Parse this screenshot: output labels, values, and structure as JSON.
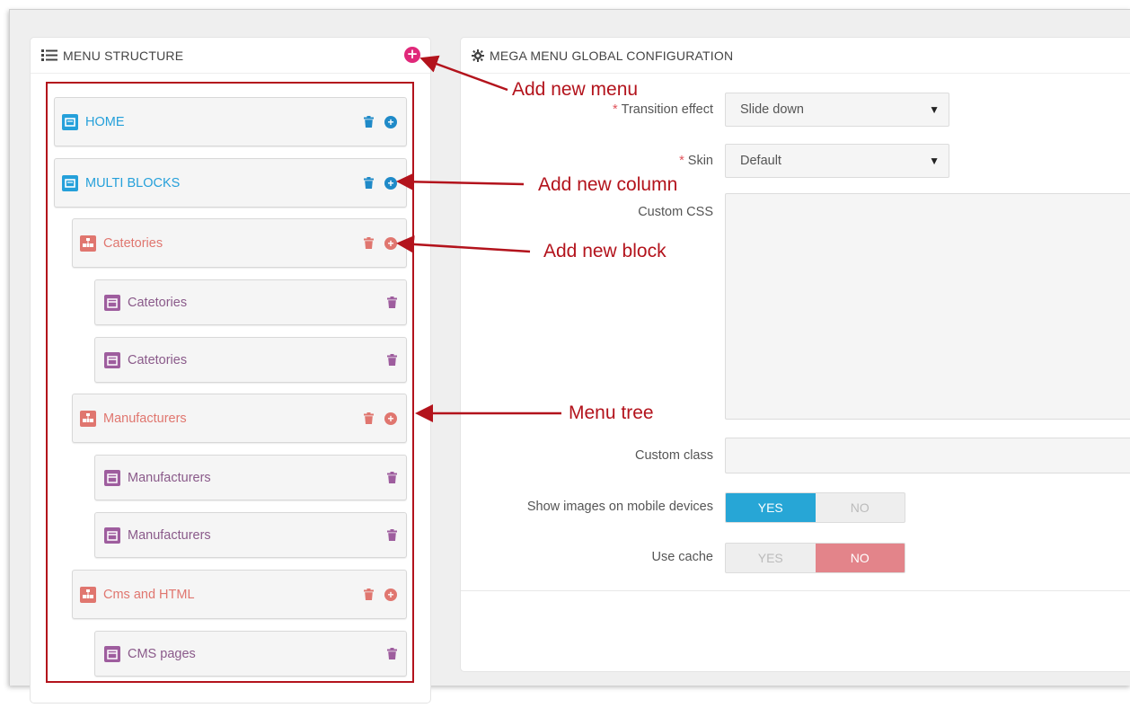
{
  "left_panel": {
    "title": "MENU STRUCTURE",
    "title_icon": "list-icon",
    "add_icon": "plus-circle-icon",
    "add_symbol": "+"
  },
  "tree": [
    {
      "label": "HOME",
      "kind": "menu",
      "icon": "book-icon",
      "color": "#25a0da",
      "actions": [
        "trash-icon",
        "plus-circle-icon"
      ]
    },
    {
      "label": "MULTI BLOCKS",
      "kind": "menu",
      "icon": "book-icon",
      "color": "#25a0da",
      "actions": [
        "trash-icon",
        "plus-circle-icon"
      ]
    },
    {
      "label": "Catetories",
      "kind": "column",
      "icon": "sitemap-icon",
      "color": "#e0766f",
      "actions": [
        "trash-icon",
        "plus-circle-icon"
      ]
    },
    {
      "label": "Catetories",
      "kind": "block",
      "icon": "calendar-icon",
      "color": "#9e5d9e",
      "actions": [
        "trash-icon"
      ]
    },
    {
      "label": "Catetories",
      "kind": "block",
      "icon": "calendar-icon",
      "color": "#9e5d9e",
      "actions": [
        "trash-icon"
      ]
    },
    {
      "label": "Manufacturers",
      "kind": "column",
      "icon": "sitemap-icon",
      "color": "#e0766f",
      "actions": [
        "trash-icon",
        "plus-circle-icon"
      ]
    },
    {
      "label": "Manufacturers",
      "kind": "block",
      "icon": "calendar-icon",
      "color": "#9e5d9e",
      "actions": [
        "trash-icon"
      ]
    },
    {
      "label": "Manufacturers",
      "kind": "block",
      "icon": "calendar-icon",
      "color": "#9e5d9e",
      "actions": [
        "trash-icon"
      ]
    },
    {
      "label": "Cms and HTML",
      "kind": "column",
      "icon": "sitemap-icon",
      "color": "#e0766f",
      "actions": [
        "trash-icon",
        "plus-circle-icon"
      ]
    },
    {
      "label": "CMS pages",
      "kind": "block",
      "icon": "calendar-icon",
      "color": "#9e5d9e",
      "actions": [
        "trash-icon"
      ]
    }
  ],
  "right_panel": {
    "title": "MEGA MENU GLOBAL CONFIGURATION",
    "title_icon": "gear-icon",
    "required_mark": "*",
    "fields": {
      "transition": {
        "label": "Transition effect",
        "value": "Slide down",
        "required": true
      },
      "skin": {
        "label": "Skin",
        "value": "Default",
        "required": true
      },
      "custom_css": {
        "label": "Custom CSS",
        "value": ""
      },
      "custom_class": {
        "label": "Custom class",
        "value": ""
      },
      "show_images": {
        "label": "Show images on mobile devices",
        "yes": "YES",
        "no": "NO",
        "selected": "YES"
      },
      "use_cache": {
        "label": "Use cache",
        "yes": "YES",
        "no": "NO",
        "selected": "NO"
      }
    }
  },
  "annotations": {
    "add_menu": "Add new menu",
    "add_column": "Add new column",
    "add_block": "Add new block",
    "menu_tree": "Menu tree",
    "color": "#b3131c"
  }
}
